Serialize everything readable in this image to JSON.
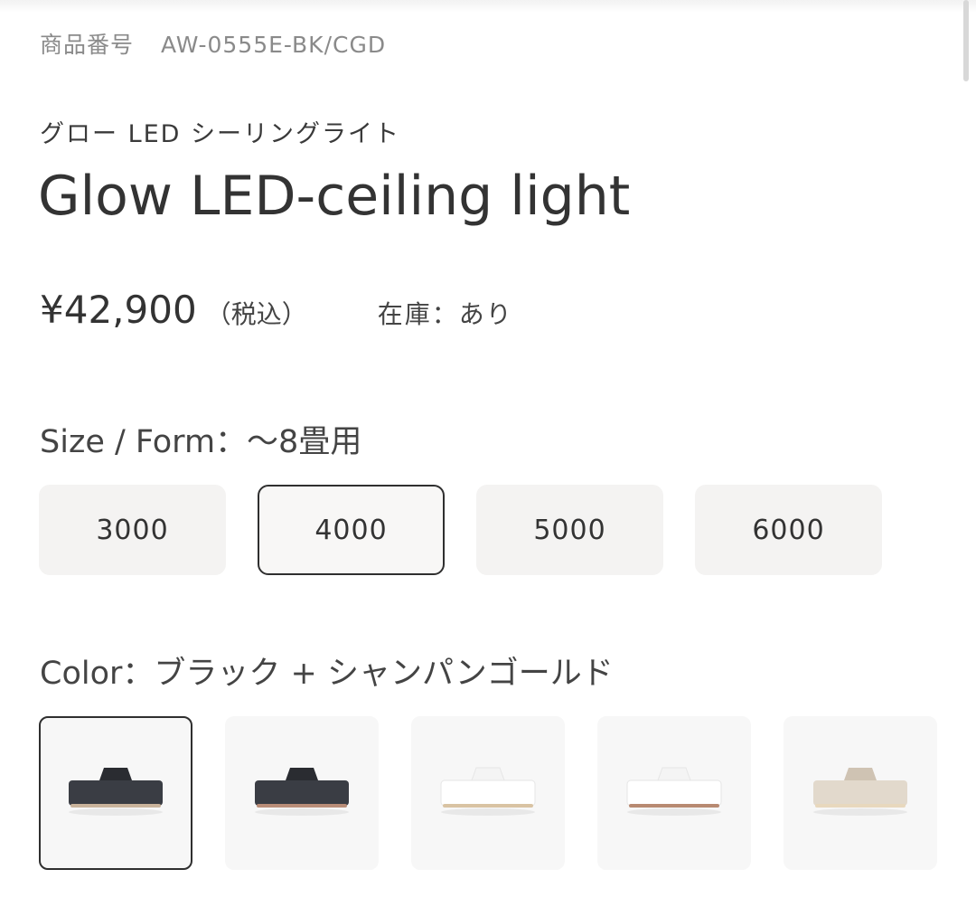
{
  "product": {
    "sku_label": "商品番号",
    "sku_value": "AW-0555E-BK/CGD",
    "name_ja": "グロー LED シーリングライト",
    "title": "Glow LED-ceiling light",
    "price": "¥42,900",
    "tax_note": "（税込）",
    "stock": "在庫：あり"
  },
  "size": {
    "label": "Size / Form：～8畳用",
    "selected_index": 1,
    "options": [
      {
        "label": "3000"
      },
      {
        "label": "4000"
      },
      {
        "label": "5000"
      },
      {
        "label": "6000"
      }
    ]
  },
  "color": {
    "label": "Color：ブラック + シャンパンゴールド",
    "selected_index": 0,
    "swatches": [
      {
        "icon": "ceiling-light-black-gold-icon",
        "shade": "#3a3d44",
        "cap": "#2a2c31",
        "rim": "#c9b39b"
      },
      {
        "icon": "ceiling-light-black-copper-icon",
        "shade": "#3a3d44",
        "cap": "#2a2c31",
        "rim": "#b98d78"
      },
      {
        "icon": "ceiling-light-white-gold-icon",
        "shade": "#ffffff",
        "cap": "#f4f4f4",
        "rim": "#d9c3a3"
      },
      {
        "icon": "ceiling-light-white-copper-icon",
        "shade": "#ffffff",
        "cap": "#f4f4f4",
        "rim": "#b88a72"
      },
      {
        "icon": "ceiling-light-beige-icon",
        "shade": "#e2d9cc",
        "cap": "#cfc3b3",
        "rim": "#e8d8bd"
      }
    ]
  }
}
